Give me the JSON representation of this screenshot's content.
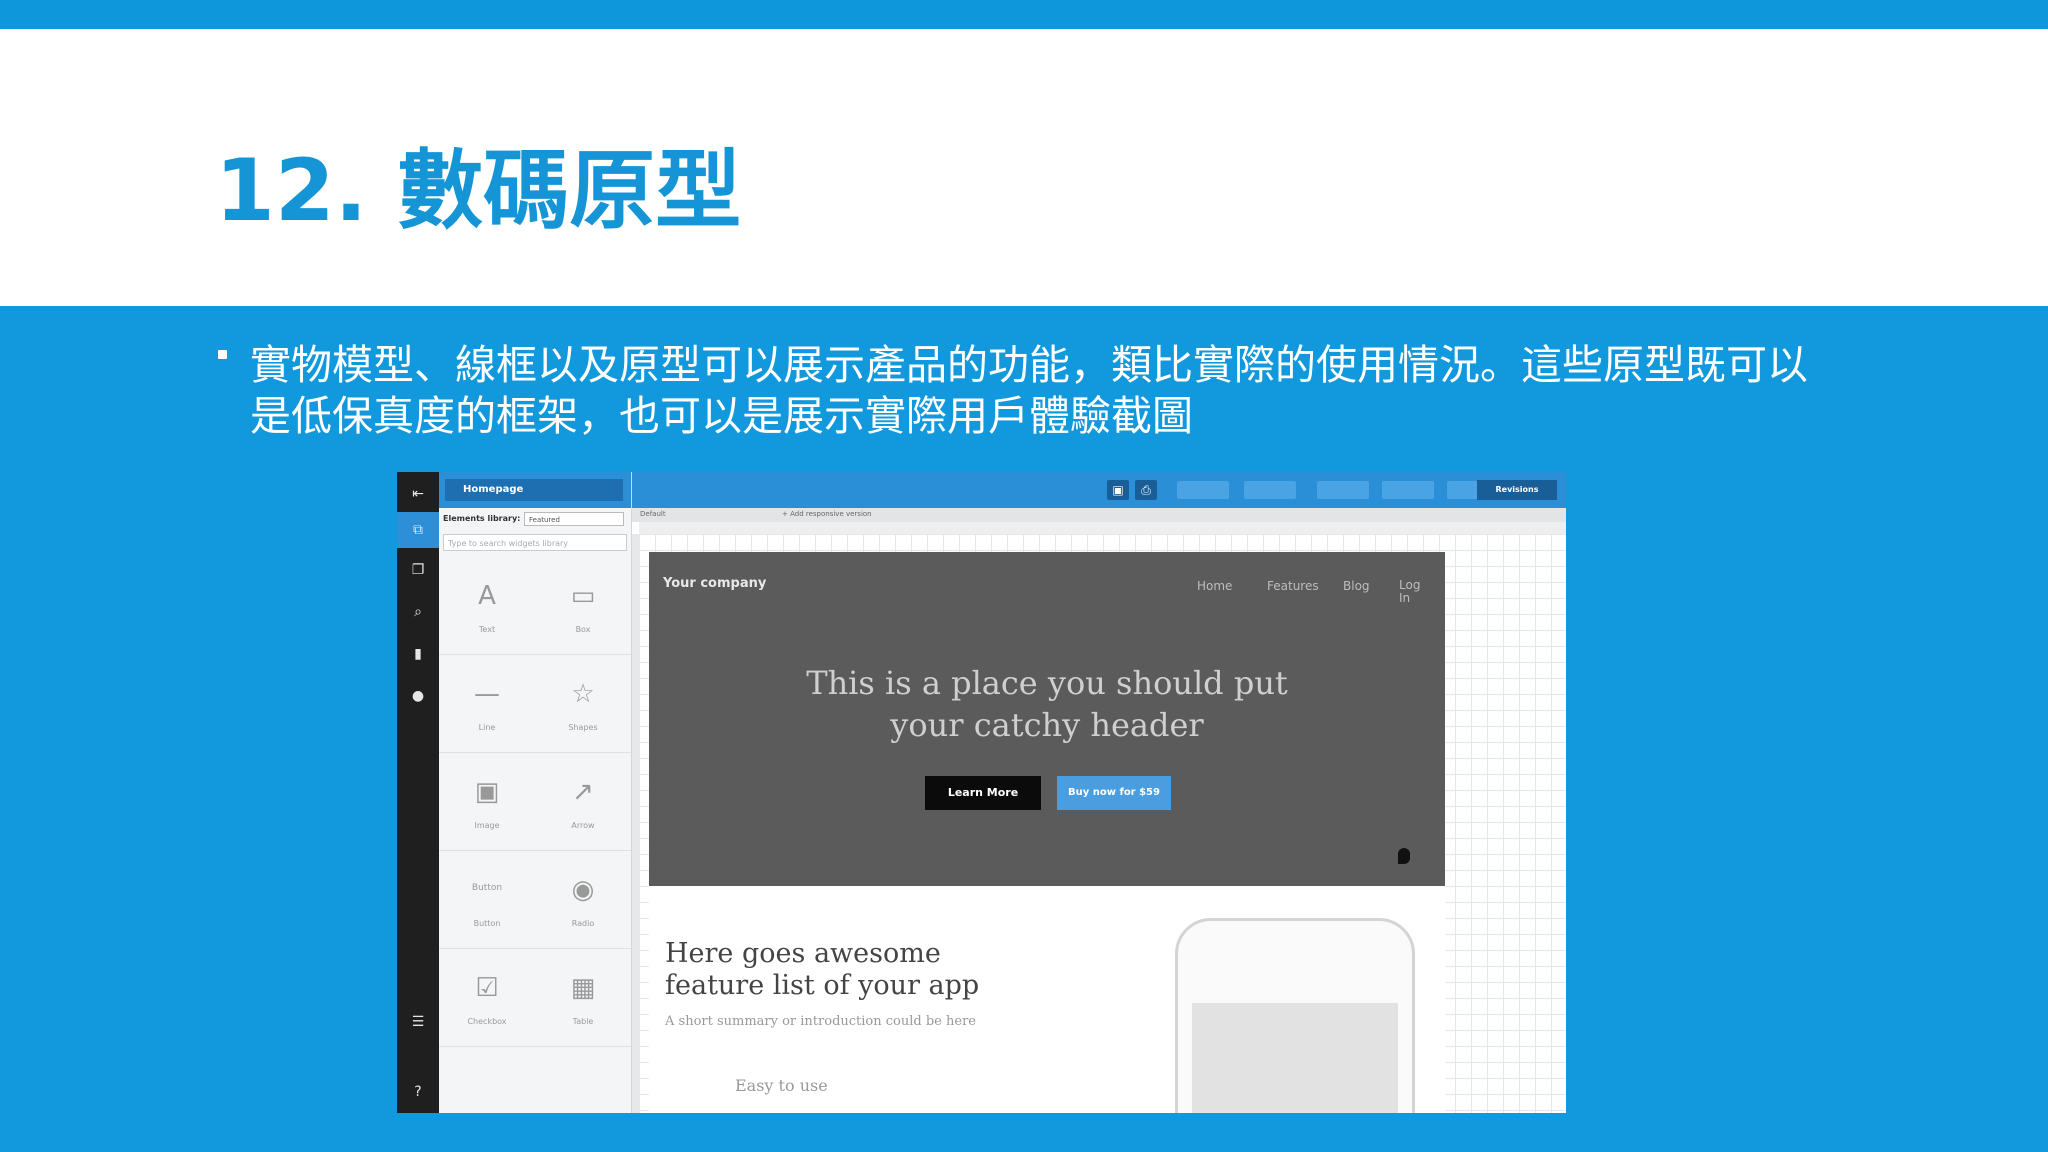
{
  "slide": {
    "title": "12. 數碼原型",
    "bullet": "實物模型、線框以及原型可以展示產品的功能，類比實際的使用情況。這些原型既可以是低保真度的框架，也可以是展示實際用戶體驗截圖"
  },
  "screenshot": {
    "panel": {
      "homepage": "Homepage",
      "elements_library_label": "Elements library:",
      "elements_library_value": "Featured",
      "search_placeholder": "Type to search widgets library",
      "widgets": [
        {
          "label": "Text",
          "glyph": "A"
        },
        {
          "label": "Box",
          "glyph": "▭"
        },
        {
          "label": "Line",
          "glyph": "—"
        },
        {
          "label": "Shapes",
          "glyph": "☆"
        },
        {
          "label": "Image",
          "glyph": "▣"
        },
        {
          "label": "Arrow",
          "glyph": "↗"
        },
        {
          "label": "Button",
          "glyph": "Button"
        },
        {
          "label": "Radio",
          "glyph": "◉"
        },
        {
          "label": "Checkbox",
          "glyph": "☑"
        },
        {
          "label": "Table",
          "glyph": "▦"
        }
      ]
    },
    "toolbar": {
      "revisions": "Revisions",
      "opacity": "Opacity"
    },
    "tabs": {
      "default": "Default",
      "add_responsive": "+ Add responsive version"
    },
    "hero": {
      "company": "Your company",
      "nav": [
        "Home",
        "Features",
        "Blog",
        "Log In"
      ],
      "headline_1": "This is a place you should put",
      "headline_2": "your catchy header",
      "learn_more": "Learn More",
      "buy_now": "Buy now for $59"
    },
    "features": {
      "heading_1": "Here goes awesome",
      "heading_2": "feature list of your app",
      "summary": "A short summary or introduction could be here",
      "easy": "Easy to use"
    }
  }
}
